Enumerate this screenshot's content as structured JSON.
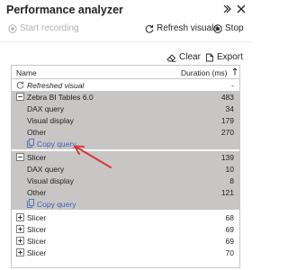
{
  "panel": {
    "title": "Performance analyzer"
  },
  "toolbar": {
    "start_recording": "Start recording",
    "refresh_visuals": "Refresh visuals",
    "stop": "Stop",
    "clear": "Clear",
    "export": "Export"
  },
  "table": {
    "columns": {
      "name": "Name",
      "duration": "Duration (ms)"
    },
    "refreshed_row": {
      "label": "Refreshed visual",
      "value": "-"
    },
    "groups": [
      {
        "label": "Zebra BI Tables 6.0",
        "value": "483",
        "children": [
          {
            "label": "DAX query",
            "value": "34"
          },
          {
            "label": "Visual display",
            "value": "179"
          },
          {
            "label": "Other",
            "value": "270"
          }
        ],
        "copy_query": "Copy query"
      },
      {
        "label": "Slicer",
        "value": "139",
        "children": [
          {
            "label": "DAX query",
            "value": "10"
          },
          {
            "label": "Visual display",
            "value": "8"
          },
          {
            "label": "Other",
            "value": "121"
          }
        ],
        "copy_query": "Copy query"
      }
    ],
    "collapsed_rows": [
      {
        "label": "Slicer",
        "value": "68"
      },
      {
        "label": "Slicer",
        "value": "69"
      },
      {
        "label": "Slicer",
        "value": "69"
      },
      {
        "label": "Slicer",
        "value": "70"
      }
    ]
  },
  "colors": {
    "selected_row_bg": "#c8c6c4",
    "link": "#3a63b8",
    "arrow": "#d93636",
    "disabled_text": "#b3b0ad"
  }
}
